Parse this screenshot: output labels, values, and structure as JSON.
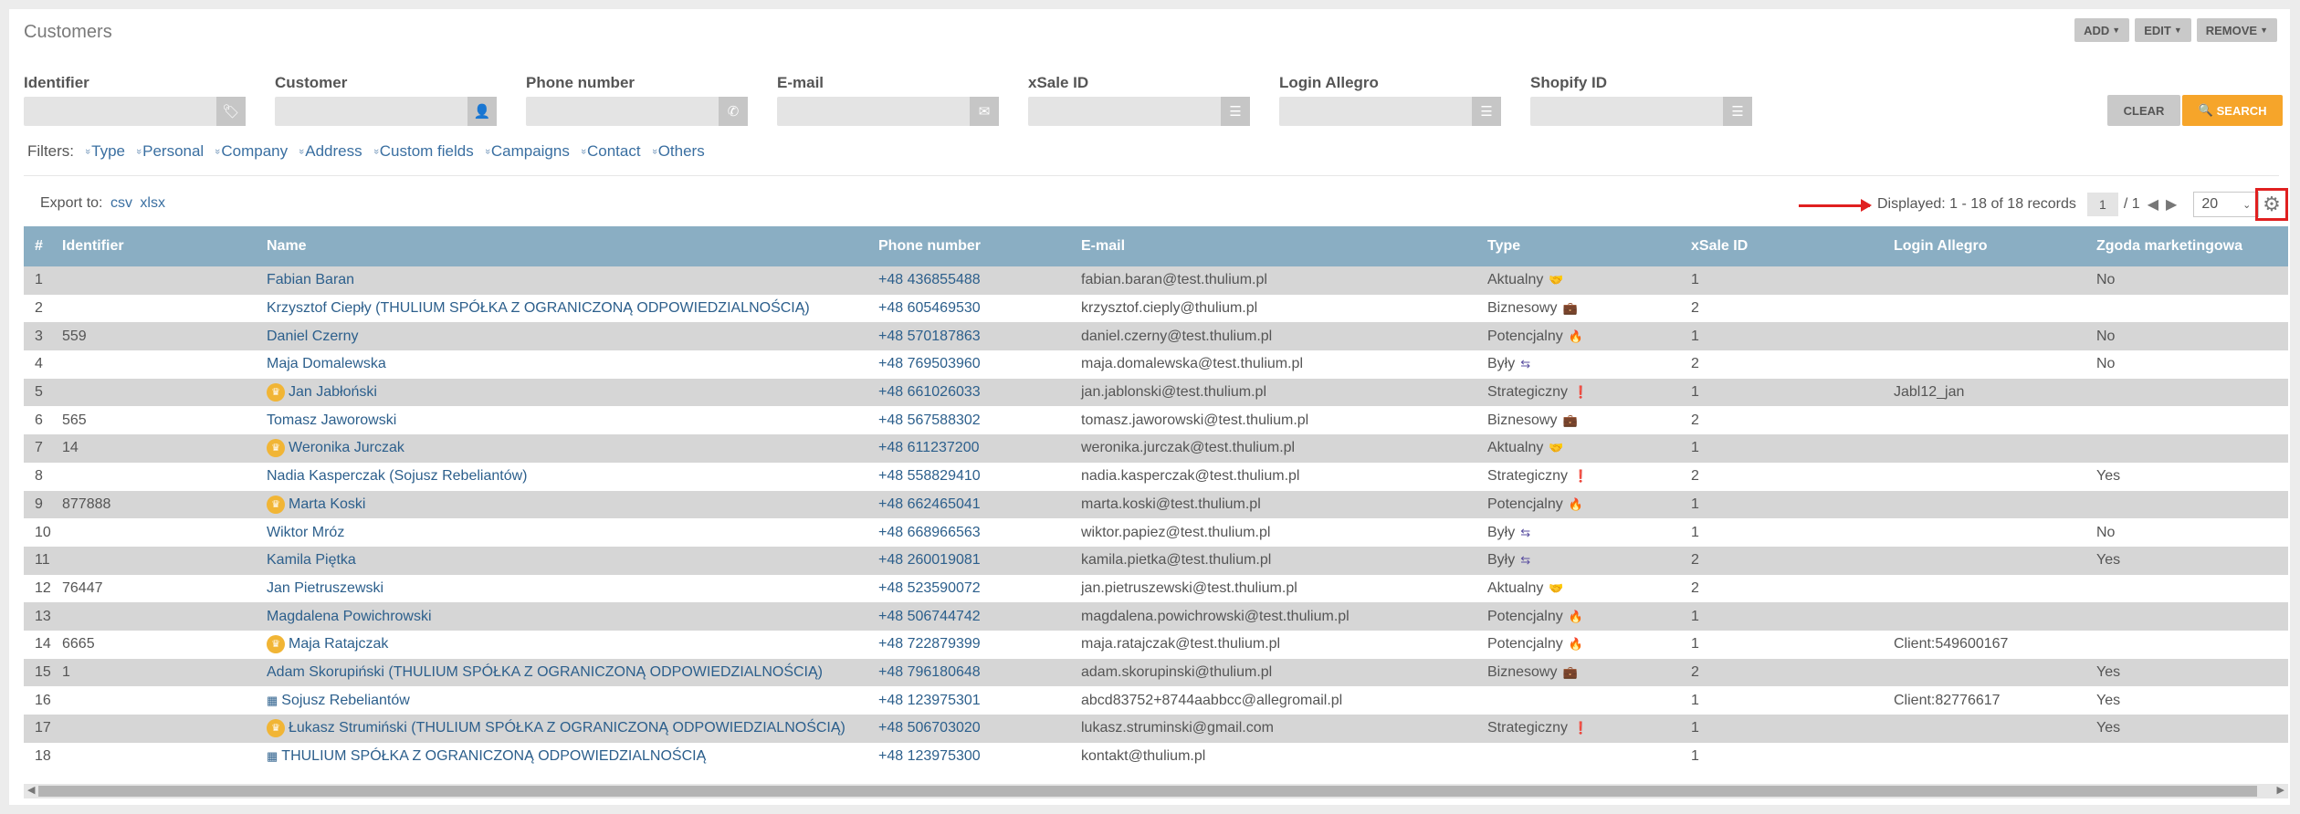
{
  "title": "Customers",
  "actions": [
    {
      "label": "ADD",
      "name": "add-button"
    },
    {
      "label": "EDIT",
      "name": "edit-button"
    },
    {
      "label": "REMOVE",
      "name": "remove-button"
    }
  ],
  "filters": [
    {
      "label": "Identifier",
      "icon": "tag-icon",
      "glyph": "🏷",
      "value": ""
    },
    {
      "label": "Customer",
      "icon": "user-icon",
      "glyph": "👤",
      "value": ""
    },
    {
      "label": "Phone number",
      "icon": "phone-icon",
      "glyph": "✆",
      "value": ""
    },
    {
      "label": "E-mail",
      "icon": "envelope-icon",
      "glyph": "✉",
      "value": ""
    },
    {
      "label": "xSale ID",
      "icon": "list-icon",
      "glyph": "☰",
      "value": ""
    },
    {
      "label": "Login Allegro",
      "icon": "list-icon",
      "glyph": "☰",
      "value": ""
    },
    {
      "label": "Shopify ID",
      "icon": "list-icon",
      "glyph": "☰",
      "value": ""
    }
  ],
  "clear_label": "CLEAR",
  "search_label": "SEARCH",
  "filter_links_label": "Filters:",
  "filter_links": [
    "Type",
    "Personal",
    "Company",
    "Address",
    "Custom fields",
    "Campaigns",
    "Contact",
    "Others"
  ],
  "export": {
    "label": "Export to:",
    "csv": "csv",
    "xlsx": "xlsx"
  },
  "pager": {
    "displayed": "Displayed: 1 - 18 of 18 records",
    "page": "1",
    "total": "/ 1",
    "page_size": "20"
  },
  "columns": [
    "#",
    "Identifier",
    "Name",
    "Phone number",
    "E-mail",
    "Type",
    "xSale ID",
    "Login Allegro",
    "Zgoda marketingowa"
  ],
  "rows": [
    {
      "n": "1",
      "id": "",
      "name": "Fabian Baran",
      "icon": "",
      "phone": "+48 436855488",
      "email": "fabian.baran@test.thulium.pl",
      "type": "Aktualny",
      "type_icon": "handshake",
      "xsale": "1",
      "allegro": "",
      "consent": "No"
    },
    {
      "n": "2",
      "id": "",
      "name": "Krzysztof Ciepły (THULIUM SPÓŁKA Z OGRANICZONĄ ODPOWIEDZIALNOŚCIĄ)",
      "icon": "",
      "phone": "+48 605469530",
      "email": "krzysztof.cieply@thulium.pl",
      "type": "Biznesowy",
      "type_icon": "briefcase",
      "xsale": "2",
      "allegro": "",
      "consent": ""
    },
    {
      "n": "3",
      "id": "559",
      "name": "Daniel Czerny",
      "icon": "",
      "phone": "+48 570187863",
      "email": "daniel.czerny@test.thulium.pl",
      "type": "Potencjalny",
      "type_icon": "flame",
      "xsale": "1",
      "allegro": "",
      "consent": "No"
    },
    {
      "n": "4",
      "id": "",
      "name": "Maja Domalewska",
      "icon": "",
      "phone": "+48 769503960",
      "email": "maja.domalewska@test.thulium.pl",
      "type": "Były",
      "type_icon": "exchange",
      "xsale": "2",
      "allegro": "",
      "consent": "No"
    },
    {
      "n": "5",
      "id": "",
      "name": "Jan Jabłoński",
      "icon": "crown",
      "phone": "+48 661026033",
      "email": "jan.jablonski@test.thulium.pl",
      "type": "Strategiczny",
      "type_icon": "exclamation",
      "xsale": "1",
      "allegro": "Jabl12_jan",
      "consent": ""
    },
    {
      "n": "6",
      "id": "565",
      "name": "Tomasz Jaworowski",
      "icon": "",
      "phone": "+48 567588302",
      "email": "tomasz.jaworowski@test.thulium.pl",
      "type": "Biznesowy",
      "type_icon": "briefcase",
      "xsale": "2",
      "allegro": "",
      "consent": ""
    },
    {
      "n": "7",
      "id": "14",
      "name": "Weronika Jurczak",
      "icon": "crown",
      "phone": "+48 611237200",
      "email": "weronika.jurczak@test.thulium.pl",
      "type": "Aktualny",
      "type_icon": "handshake",
      "xsale": "1",
      "allegro": "",
      "consent": ""
    },
    {
      "n": "8",
      "id": "",
      "name": "Nadia Kasperczak (Sojusz Rebeliantów)",
      "icon": "",
      "phone": "+48 558829410",
      "email": "nadia.kasperczak@test.thulium.pl",
      "type": "Strategiczny",
      "type_icon": "exclamation",
      "xsale": "2",
      "allegro": "",
      "consent": "Yes"
    },
    {
      "n": "9",
      "id": "877888",
      "name": "Marta Koski",
      "icon": "crown",
      "phone": "+48 662465041",
      "email": "marta.koski@test.thulium.pl",
      "type": "Potencjalny",
      "type_icon": "flame",
      "xsale": "1",
      "allegro": "",
      "consent": ""
    },
    {
      "n": "10",
      "id": "",
      "name": "Wiktor Mróz",
      "icon": "",
      "phone": "+48 668966563",
      "email": "wiktor.papiez@test.thulium.pl",
      "type": "Były",
      "type_icon": "exchange",
      "xsale": "1",
      "allegro": "",
      "consent": "No"
    },
    {
      "n": "11",
      "id": "",
      "name": "Kamila Piętka",
      "icon": "",
      "phone": "+48 260019081",
      "email": "kamila.pietka@test.thulium.pl",
      "type": "Były",
      "type_icon": "exchange",
      "xsale": "2",
      "allegro": "",
      "consent": "Yes"
    },
    {
      "n": "12",
      "id": "76447",
      "name": "Jan Pietruszewski",
      "icon": "",
      "phone": "+48 523590072",
      "email": "jan.pietruszewski@test.thulium.pl",
      "type": "Aktualny",
      "type_icon": "handshake",
      "xsale": "2",
      "allegro": "",
      "consent": ""
    },
    {
      "n": "13",
      "id": "",
      "name": "Magdalena Powichrowski",
      "icon": "",
      "phone": "+48 506744742",
      "email": "magdalena.powichrowski@test.thulium.pl",
      "type": "Potencjalny",
      "type_icon": "flame",
      "xsale": "1",
      "allegro": "",
      "consent": ""
    },
    {
      "n": "14",
      "id": "6665",
      "name": "Maja Ratajczak",
      "icon": "crown",
      "phone": "+48 722879399",
      "email": "maja.ratajczak@test.thulium.pl",
      "type": "Potencjalny",
      "type_icon": "flame",
      "xsale": "1",
      "allegro": "Client:549600167",
      "consent": ""
    },
    {
      "n": "15",
      "id": "1",
      "name": "Adam Skorupiński (THULIUM SPÓŁKA Z OGRANICZONĄ ODPOWIEDZIALNOŚCIĄ)",
      "icon": "",
      "phone": "+48 796180648",
      "email": "adam.skorupinski@thulium.pl",
      "type": "Biznesowy",
      "type_icon": "briefcase",
      "xsale": "2",
      "allegro": "",
      "consent": "Yes"
    },
    {
      "n": "16",
      "id": "",
      "name": "Sojusz Rebeliantów",
      "icon": "building",
      "phone": "+48 123975301",
      "email": "abcd83752+8744aabbcc@allegromail.pl",
      "type": "",
      "type_icon": "",
      "xsale": "1",
      "allegro": "Client:82776617",
      "consent": "Yes"
    },
    {
      "n": "17",
      "id": "",
      "name": "Łukasz Strumiński (THULIUM SPÓŁKA Z OGRANICZONĄ ODPOWIEDZIALNOŚCIĄ)",
      "icon": "crown",
      "phone": "+48 506703020",
      "email": "lukasz.struminski@gmail.com",
      "type": "Strategiczny",
      "type_icon": "exclamation",
      "xsale": "1",
      "allegro": "",
      "consent": "Yes"
    },
    {
      "n": "18",
      "id": "",
      "name": "THULIUM SPÓŁKA Z OGRANICZONĄ ODPOWIEDZIALNOŚCIĄ",
      "icon": "building",
      "phone": "+48 123975300",
      "email": "kontakt@thulium.pl",
      "type": "",
      "type_icon": "",
      "xsale": "1",
      "allegro": "",
      "consent": ""
    }
  ]
}
